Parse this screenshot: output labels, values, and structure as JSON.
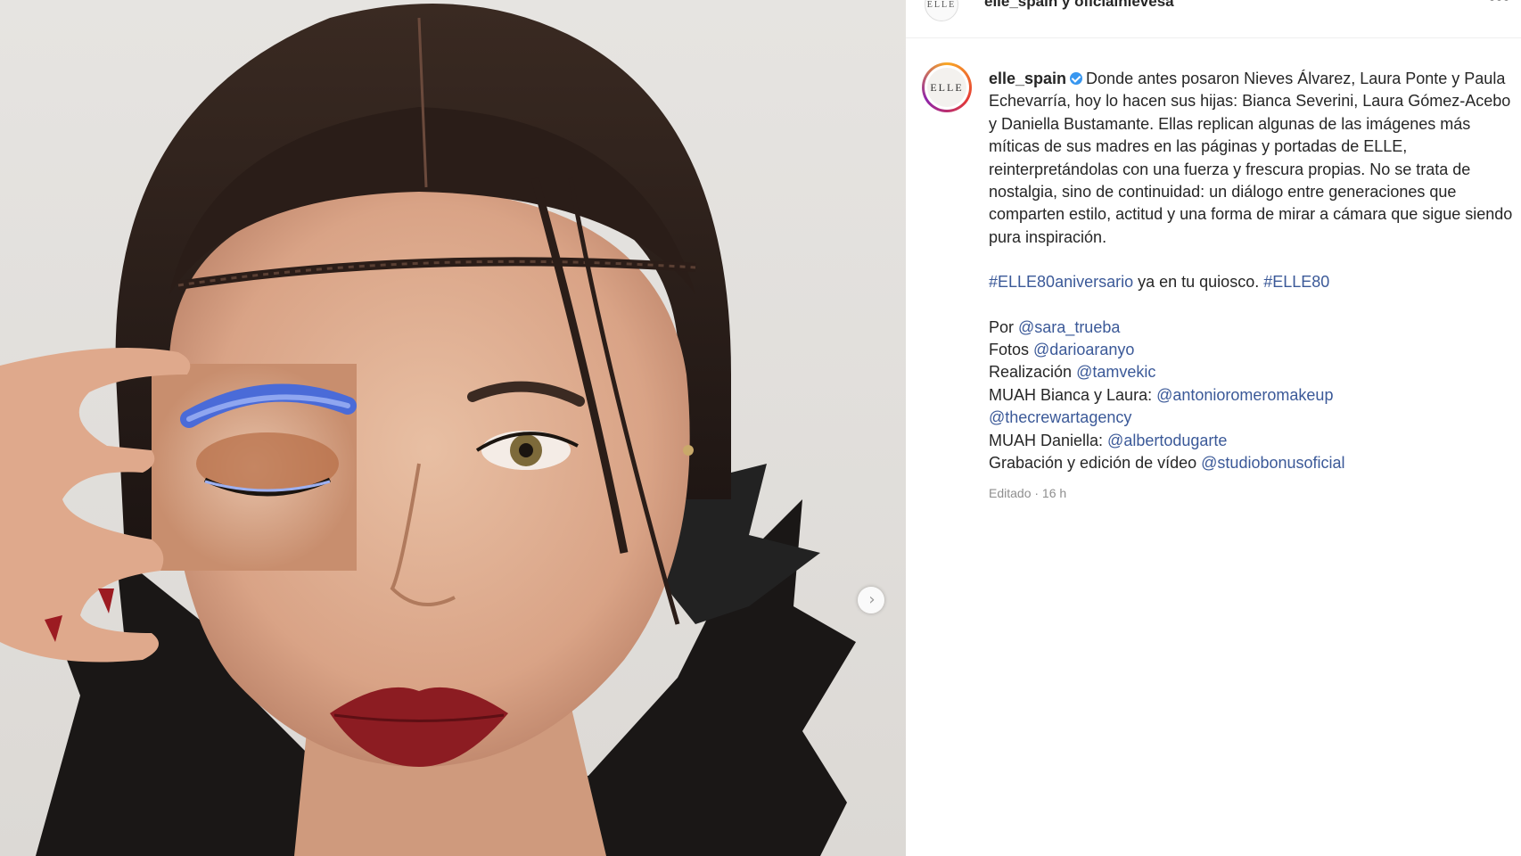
{
  "header": {
    "title": "elle_spain y oficialnievesa",
    "avatar_text": "ELLE",
    "more_icon": "more-horizontal-icon"
  },
  "post": {
    "avatar_text": "ELLE",
    "username": "elle_spain",
    "verified_icon": "verified-badge-icon",
    "body": "Donde antes posaron Nieves Álvarez, Laura Ponte y Paula Echevarría, hoy lo hacen sus hijas: Bianca Severini, Laura Gómez-Acebo y Daniella Bustamante. Ellas replican algunas de las imágenes más míticas de sus madres en las páginas y portadas de ELLE, reinterpretándolas con una fuerza y frescura propias. No se trata de nostalgia, sino de continuidad: un diálogo entre generaciones que comparten estilo, actitud y una forma de mirar a cámara que sigue siendo pura inspiración.",
    "hashtag1": "#ELLE80aniversario",
    "hashtag_text": " ya en tu quiosco. ",
    "hashtag2": "#ELLE80",
    "credits": [
      {
        "label": "Por ",
        "handle": "@sara_trueba"
      },
      {
        "label": "Fotos ",
        "handle": "@darioaranyo"
      },
      {
        "label": "Realización ",
        "handle": "@tamvekic"
      },
      {
        "label": "MUAH Bianca y Laura: ",
        "handle": "@antonioromeromakeup"
      },
      {
        "label": "",
        "handle": "@thecrewartagency"
      },
      {
        "label": "MUAH Daniella: ",
        "handle": "@albertodugarte"
      },
      {
        "label": "Grabación y edición de vídeo ",
        "handle": "@studiobonusoficial"
      }
    ],
    "timestamp": "Editado · 16 h"
  },
  "carousel": {
    "next_icon": "chevron-right-icon",
    "next_glyph": "›"
  },
  "colors": {
    "link": "#3b5998",
    "text": "#262626",
    "muted": "#8e8e8e",
    "verified": "#3897f0"
  }
}
